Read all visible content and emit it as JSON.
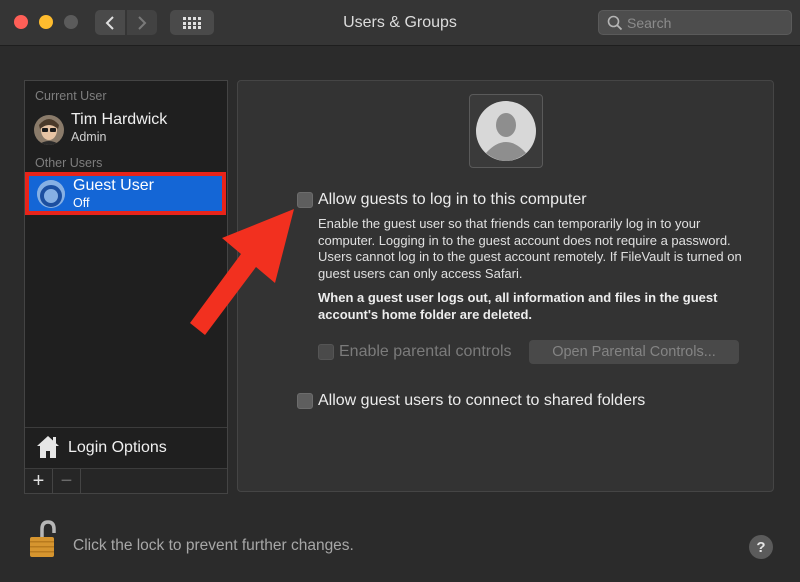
{
  "window": {
    "title": "Users & Groups",
    "search_placeholder": "Search"
  },
  "sidebar": {
    "current_user_label": "Current User",
    "current_user": {
      "name": "Tim Hardwick",
      "role": "Admin"
    },
    "other_users_label": "Other Users",
    "guest_user": {
      "name": "Guest User",
      "status": "Off"
    },
    "login_options_label": "Login Options",
    "add_label": "+",
    "remove_label": "−"
  },
  "main": {
    "allow_guests_label": "Allow guests to log in to this computer",
    "allow_guests_description": "Enable the guest user so that friends can temporarily log in to your computer. Logging in to the guest account does not require a password. Users cannot log in to the guest account remotely. If FileVault is turned on guest users can only access Safari.",
    "guest_warning": "When a guest user logs out, all information and files in the guest account's home folder are deleted.",
    "parental_controls_label": "Enable parental controls",
    "open_parental_controls_label": "Open Parental Controls...",
    "shared_folders_label": "Allow guest users to connect to shared folders"
  },
  "footer": {
    "lock_text": "Click the lock to prevent further changes.",
    "help_label": "?"
  },
  "colors": {
    "selection": "#1466d6",
    "highlight_outline": "#e8241a",
    "arrow": "#f2301f"
  }
}
